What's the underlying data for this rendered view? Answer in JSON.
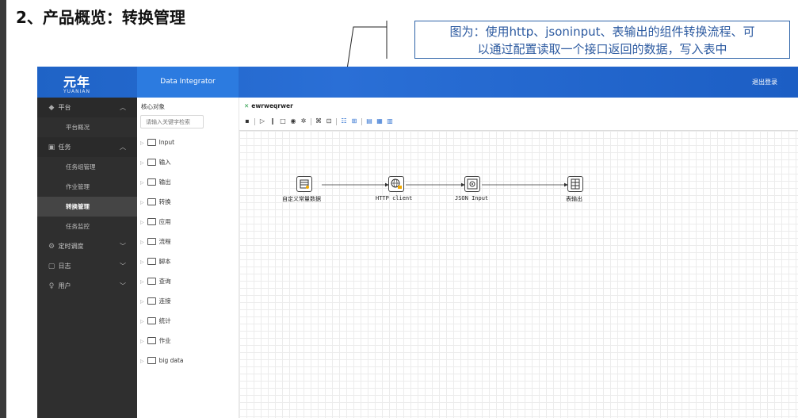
{
  "slide": {
    "title": "2、产品概览：转换管理",
    "callout_line1": "图为：使用http、jsoninput、表输出的组件转换流程、可",
    "callout_line2": "以通过配置读取一个接口返回的数据，写入表中"
  },
  "header": {
    "logo_main": "元年",
    "logo_sub": "YUANIAN",
    "app_name": "Data Integrator",
    "logout": "退出登录"
  },
  "sidebar": {
    "groups": [
      {
        "label": "平台",
        "icon": "layers-icon",
        "chevron": "up"
      },
      {
        "label": "任务",
        "icon": "calendar-icon",
        "chevron": "up"
      },
      {
        "label": "定时调度",
        "icon": "gear-icon",
        "chevron": "down"
      },
      {
        "label": "日志",
        "icon": "log-icon",
        "chevron": "down"
      },
      {
        "label": "用户",
        "icon": "user-icon",
        "chevron": "down"
      }
    ],
    "platform_items": [
      "平台概况"
    ],
    "task_items": [
      "任务组管理",
      "作业管理",
      "转换管理",
      "任务监控"
    ],
    "active_item": "转换管理"
  },
  "tree": {
    "title": "核心对象",
    "search_placeholder": "请输入关键字检索",
    "items": [
      "Input",
      "输入",
      "输出",
      "转换",
      "应用",
      "流程",
      "脚本",
      "查询",
      "连接",
      "统计",
      "作业",
      "big data"
    ]
  },
  "canvas": {
    "tab_title": "ewrweqrwer",
    "nodes": [
      {
        "label": "自定义常量数据",
        "icon": "constant-data-icon"
      },
      {
        "label": "HTTP client",
        "icon": "http-client-icon"
      },
      {
        "label": "JSON Input",
        "icon": "json-input-icon"
      },
      {
        "label": "表输出",
        "icon": "table-output-icon"
      }
    ]
  },
  "colors": {
    "header_blue": "#1f63c6",
    "sidebar_dark": "#2f2f2f",
    "callout_blue": "#2c5aa0"
  }
}
